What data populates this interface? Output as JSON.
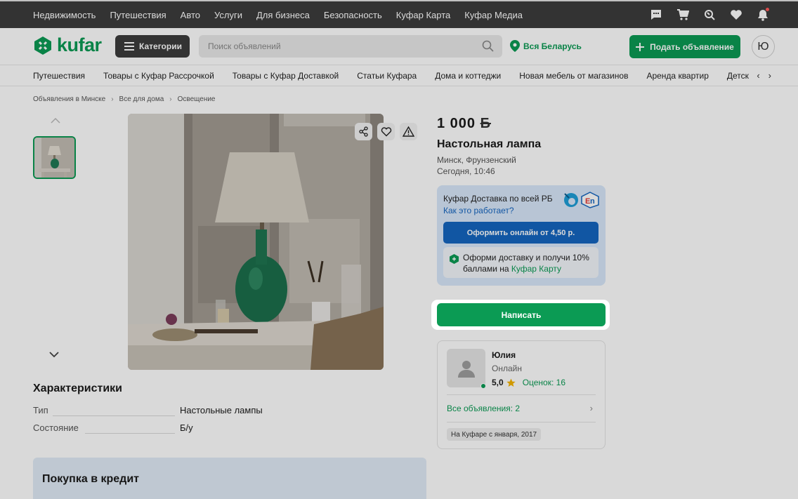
{
  "topbar": {
    "links": [
      "Недвижимость",
      "Путешествия",
      "Авто",
      "Услуги",
      "Для бизнеса",
      "Безопасность",
      "Куфар Карта",
      "Куфар Медиа"
    ],
    "icons": [
      "chat-icon",
      "cart-icon",
      "compare-icon",
      "heart-icon",
      "bell-icon"
    ]
  },
  "header": {
    "logo": "kufar",
    "categories_label": "Категории",
    "search_placeholder": "Поиск объявлений",
    "region": "Вся Беларусь",
    "post_label": "Подать объявление",
    "avatar_letter": "Ю"
  },
  "subnav": {
    "items": [
      "Путешествия",
      "Товары с Куфар Рассрочкой",
      "Товары с Куфар Доставкой",
      "Статьи Куфара",
      "Дома и коттеджи",
      "Новая мебель от магазинов",
      "Аренда квартир",
      "Детск"
    ]
  },
  "breadcrumbs": [
    "Объявления в Минске",
    "Все для дома",
    "Освещение"
  ],
  "listing": {
    "price": "1 000",
    "currency": "Б",
    "title": "Настольная лампа",
    "location": "Минск, Фрунзенский",
    "date": "Сегодня, 10:46"
  },
  "delivery": {
    "title": "Куфар Доставка по всей РБ",
    "link": "Как это работает?",
    "button": "Оформить онлайн от 4,50 р.",
    "promo_text": "Оформи доставку и получи 10% баллами на ",
    "promo_link": "Куфар Карту"
  },
  "write_button": "Написать",
  "seller": {
    "name": "Юлия",
    "status": "Онлайн",
    "rating": "5,0",
    "reviews": "Оценок: 16",
    "all_ads": "Все объявления: 2",
    "since": "На Куфаре с января, 2017"
  },
  "characteristics": {
    "title": "Характеристики",
    "rows": [
      {
        "label": "Тип",
        "value": "Настольные лампы"
      },
      {
        "label": "Состояние",
        "value": "Б/у"
      }
    ]
  },
  "credit": {
    "title": "Покупка в кредит"
  },
  "colors": {
    "brand": "#0b9b54",
    "delivery_blue": "#1565c0",
    "topbar": "#3c3c3c"
  }
}
